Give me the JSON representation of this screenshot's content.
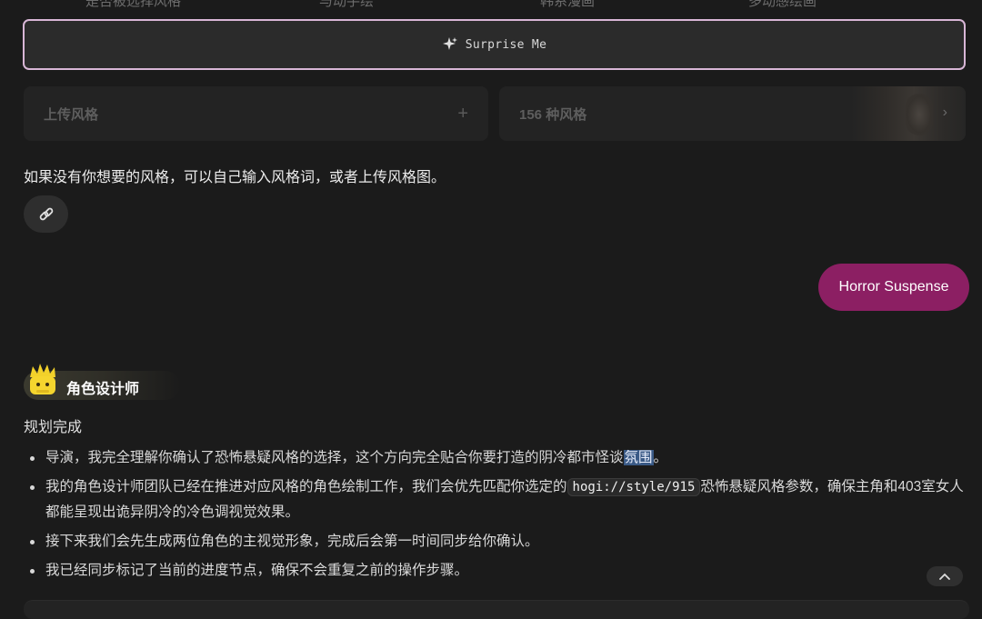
{
  "top_tabs": [
    "是否被选择风格",
    "与动手绘",
    "韩系漫画",
    "多动感绘画"
  ],
  "surprise": {
    "label": "Surprise Me",
    "icon": "sparkle-icon"
  },
  "cards": {
    "upload_label": "上传风格",
    "styles_label": "156 种风格"
  },
  "hint": "如果没有你想要的风格，可以自己输入风格词，或者上传风格图。",
  "link_button": {
    "icon": "link-icon"
  },
  "user_message": "Horror Suspense",
  "role": {
    "name": "角色设计师",
    "icon": "crown-character-icon"
  },
  "status": "规划完成",
  "bullets": {
    "b1_pre": "导演，我完全理解你确认了恐怖悬疑风格的选择，这个方向完全贴合你要打造的阴冷都市怪谈",
    "b1_hl": "氛围",
    "b1_post": "。",
    "b2_pre": "我的角色设计师团队已经在推进对应风格的角色绘制工作，我们会优先匹配你选定的",
    "b2_code": "hogi://style/915",
    "b2_post": "恐怖悬疑风格参数，确保主角和403室女人都能呈现出诡异阴冷的冷色调视觉效果。",
    "b3": "接下来我们会先生成两位角色的主视觉形象，完成后会第一时间同步给你确认。",
    "b4": "我已经同步标记了当前的进度节点，确保不会重复之前的操作步骤。"
  },
  "colors": {
    "accent": "#8c1f63",
    "border_highlight": "#d8b6d6"
  }
}
